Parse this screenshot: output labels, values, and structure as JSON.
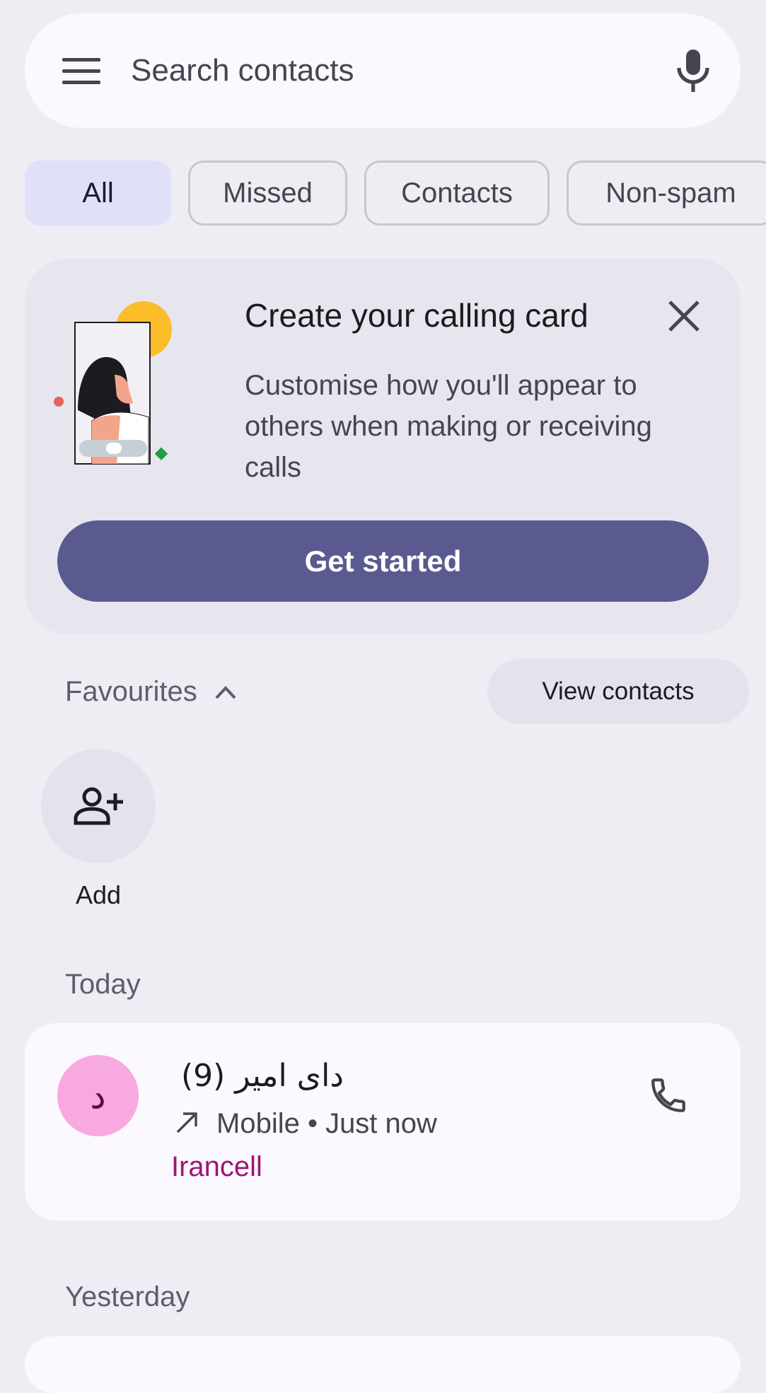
{
  "search": {
    "placeholder": "Search contacts"
  },
  "filters": [
    {
      "label": "All",
      "active": true
    },
    {
      "label": "Missed",
      "active": false
    },
    {
      "label": "Contacts",
      "active": false
    },
    {
      "label": "Non-spam",
      "active": false
    }
  ],
  "calling_card": {
    "title": "Create your calling card",
    "description": "Customise how you'll appear to others when making or receiving calls",
    "button_label": "Get started"
  },
  "favourites": {
    "label": "Favourites",
    "view_contacts_label": "View contacts",
    "add_label": "Add"
  },
  "sections": {
    "today": "Today",
    "yesterday": "Yesterday"
  },
  "calls": [
    {
      "avatar_letter": "د",
      "name": "دای امیر",
      "count": "(9)",
      "direction_icon": "outgoing-arrow-icon",
      "meta": "Mobile • Just now",
      "carrier": "Irancell"
    }
  ],
  "colors": {
    "background": "#efedf4",
    "surface": "#fbf8ff",
    "primary_button": "#5a5a91",
    "active_chip": "#e0e0f9",
    "avatar": "#f8a9df",
    "carrier_text": "#9c1674"
  }
}
